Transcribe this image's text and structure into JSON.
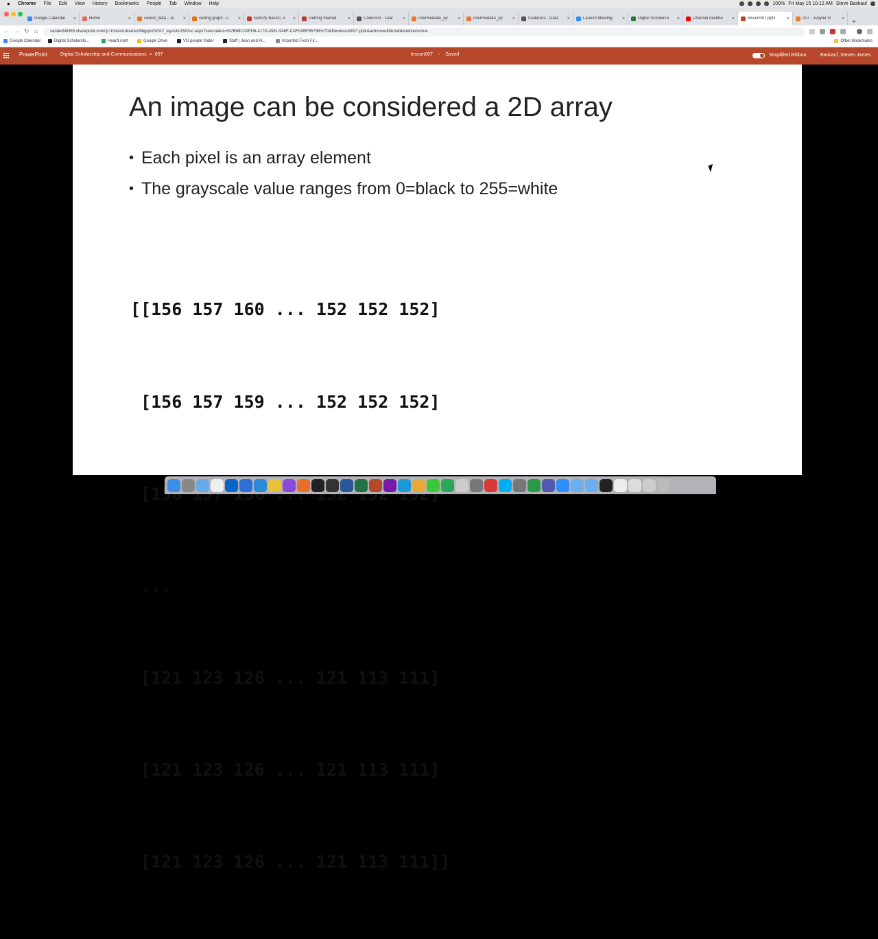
{
  "menubar": {
    "items": [
      "Chrome",
      "File",
      "Edit",
      "View",
      "History",
      "Bookmarks",
      "People",
      "Tab",
      "Window",
      "Help"
    ],
    "battery": "100%",
    "clock": "Fri May 15  10:12 AM",
    "user": "Steve Baskauf"
  },
  "tabs": [
    {
      "label": "Google Calendar",
      "color": "#4285f4"
    },
    {
      "label": "Home",
      "color": "#e66"
    },
    {
      "label": "collect_data - Ju",
      "color": "#f37626"
    },
    {
      "label": "coding graph - u",
      "color": "#e8710a"
    },
    {
      "label": "NumPy Basics: A",
      "color": "#c0392b"
    },
    {
      "label": "Getting Started",
      "color": "#c0392b"
    },
    {
      "label": "CodeGrsf - Lear",
      "color": "#555"
    },
    {
      "label": "intermediate_py",
      "color": "#f37626"
    },
    {
      "label": "intermediate_py",
      "color": "#f37626"
    },
    {
      "label": "CodeGrsf - Data",
      "color": "#555"
    },
    {
      "label": "Launch Meeting",
      "color": "#2d8cff"
    },
    {
      "label": "Digital Scholarsh",
      "color": "#1a7f37"
    },
    {
      "label": "Channel dashbo",
      "color": "#e00"
    },
    {
      "label": "lesson007.pptx",
      "color": "#b7472a"
    },
    {
      "label": "007 - Jupyter N",
      "color": "#f37626"
    }
  ],
  "address": {
    "url": "vanderbilt365.sharepoint.com/:p:/r/sites/Libraries/libgrps/DiSC/_layouts/15/Doc.aspx?sourcedoc=%7B68C2AFD6-417D-4581-948F-CAF0ABF85796%7D&file=lesson007.pptx&action=edit&mobileredirect=true"
  },
  "bookmarks": {
    "items": [
      {
        "label": "Google Calendar",
        "color": "#4285f4"
      },
      {
        "label": "Digital Scholarshi...",
        "color": "#222"
      },
      {
        "label": "Heard Alert",
        "color": "#2a6"
      },
      {
        "label": "Google Drive",
        "color": "#fbbc04"
      },
      {
        "label": "VU people finder",
        "color": "#222"
      },
      {
        "label": "Staff | Jean and Al...",
        "color": "#222"
      },
      {
        "label": "Imported From Fir...",
        "color": "#888"
      }
    ],
    "other": "Other Bookmarks"
  },
  "ppt": {
    "app": "PowerPoint",
    "breadcrumb_site": "Digital Scholarship and Communications",
    "breadcrumb_sep": ">",
    "breadcrumb_folder": "007",
    "doc_name": "lesson007",
    "doc_sep": "-",
    "doc_status": "Saved",
    "simplified_ribbon": "Simplified Ribbon",
    "user": "Baskauf, Steven James",
    "accent": "#b7472a"
  },
  "slide": {
    "title": "An image can be considered a 2D array",
    "bullets": [
      "Each pixel is an array element",
      "The grayscale value ranges from 0=black to 255=white"
    ],
    "code_lines": [
      "[[156 157 160 ... 152 152 152]",
      " [156 157 159 ... 152 152 152]",
      " [158 157 156 ... 152 152 152]",
      " ...",
      " [121 123 126 ... 121 113 111]",
      " [121 123 126 ... 121 113 111]",
      " [121 123 126 ... 121 113 111]]"
    ]
  },
  "dock": {
    "apps": [
      {
        "name": "finder-icon",
        "color": "#3d8ee8"
      },
      {
        "name": "launchpad-icon",
        "color": "#888"
      },
      {
        "name": "safari-icon",
        "color": "#6aa9e8"
      },
      {
        "name": "textedit-icon",
        "color": "#eee"
      },
      {
        "name": "outlook-icon",
        "color": "#0a64c8"
      },
      {
        "name": "editor-icon",
        "color": "#2d6fd8"
      },
      {
        "name": "vscode-icon",
        "color": "#2a8ad8"
      },
      {
        "name": "chrome-icon",
        "color": "#e8c03a"
      },
      {
        "name": "app-icon",
        "color": "#8a4ad8"
      },
      {
        "name": "firefox-icon",
        "color": "#e8702a"
      },
      {
        "name": "terminal-icon",
        "color": "#222"
      },
      {
        "name": "terminal2-icon",
        "color": "#333"
      },
      {
        "name": "word-icon",
        "color": "#2b579a"
      },
      {
        "name": "excel-icon",
        "color": "#217346"
      },
      {
        "name": "powerpoint-icon",
        "color": "#b7472a"
      },
      {
        "name": "onenote-icon",
        "color": "#7719aa"
      },
      {
        "name": "app2-icon",
        "color": "#1a9ad8"
      },
      {
        "name": "photos-icon",
        "color": "#e8a83a"
      },
      {
        "name": "messages-icon",
        "color": "#3ac83a"
      },
      {
        "name": "facetime-icon",
        "color": "#2aa85a"
      },
      {
        "name": "music-icon",
        "color": "#ccc"
      },
      {
        "name": "prefs-icon",
        "color": "#777"
      },
      {
        "name": "app3-icon",
        "color": "#d83a3a"
      },
      {
        "name": "skype-icon",
        "color": "#00aff0"
      },
      {
        "name": "app4-icon",
        "color": "#777"
      },
      {
        "name": "app5-icon",
        "color": "#2a9a4a"
      },
      {
        "name": "teams-icon",
        "color": "#5558af"
      },
      {
        "name": "zoom-icon",
        "color": "#2d8cff"
      },
      {
        "name": "folder-icon",
        "color": "#6ab0f0"
      },
      {
        "name": "folder2-icon",
        "color": "#6ab0f0"
      },
      {
        "name": "vanderbilt-icon",
        "color": "#222"
      },
      {
        "name": "window-icon",
        "color": "#eee"
      },
      {
        "name": "window2-icon",
        "color": "#ddd"
      },
      {
        "name": "window3-icon",
        "color": "#ccc"
      },
      {
        "name": "trash-icon",
        "color": "#bbb"
      }
    ]
  }
}
